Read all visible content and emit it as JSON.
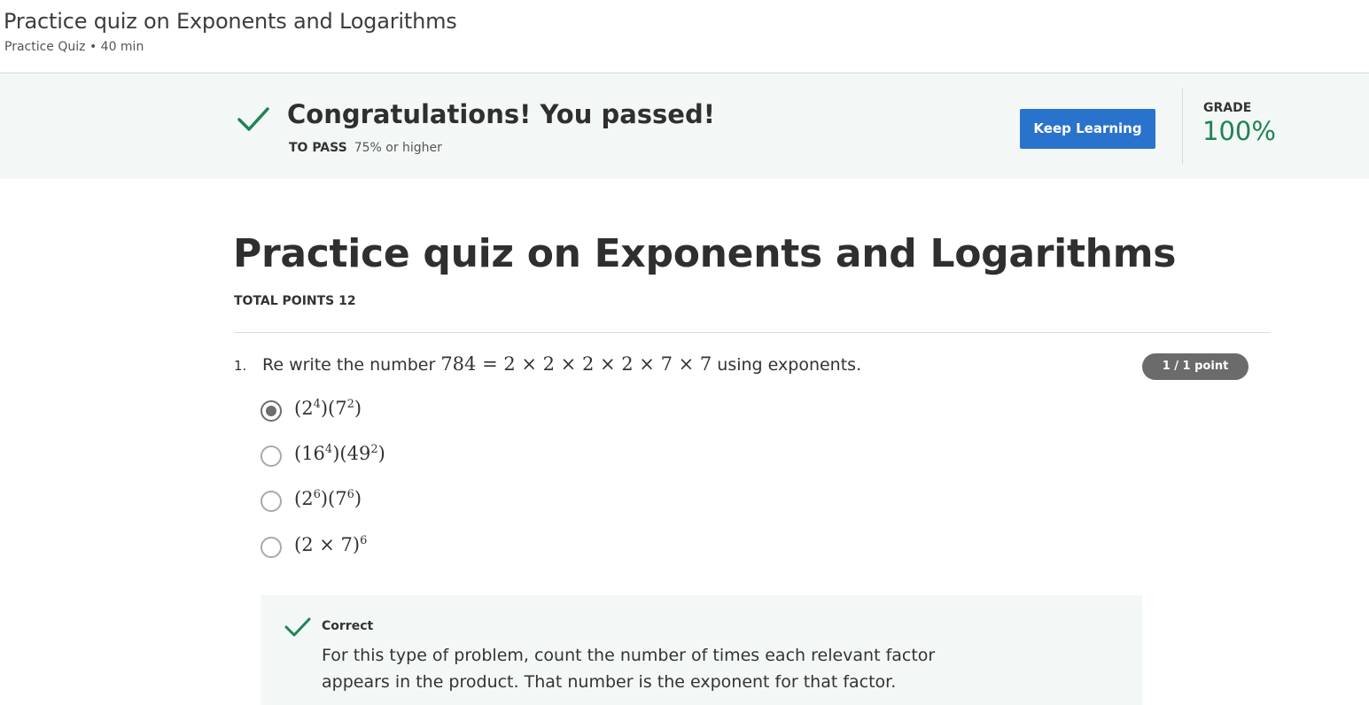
{
  "header": {
    "title": "Practice quiz on Exponents and Logarithms",
    "meta": "Practice Quiz • 40 min"
  },
  "banner": {
    "headline": "Congratulations! You passed!",
    "to_pass_label": "TO PASS",
    "to_pass_value": "75% or higher",
    "button_label": "Keep Learning",
    "grade_label": "GRADE",
    "grade_value": "100%"
  },
  "quiz": {
    "title": "Practice quiz on Exponents and Logarithms",
    "total_points": "TOTAL POINTS 12"
  },
  "question": {
    "number": "1.",
    "prefix": "Re write the number",
    "expression": "784 = 2 × 2 × 2 × 2 × 7 × 7",
    "suffix": "using exponents.",
    "points": "1 / 1 point",
    "options": [
      {
        "base1": "(2",
        "exp1": "4",
        "mid": ")(7",
        "exp2": "2",
        "end": ")",
        "selected": true
      },
      {
        "base1": "(16",
        "exp1": "4",
        "mid": ")(49",
        "exp2": "2",
        "end": ")",
        "selected": false
      },
      {
        "base1": "(2",
        "exp1": "6",
        "mid": ")(7",
        "exp2": "6",
        "end": ")",
        "selected": false
      },
      {
        "base1": "(2 × 7)",
        "exp1": "6",
        "mid": "",
        "exp2": "",
        "end": "",
        "selected": false
      }
    ]
  },
  "feedback": {
    "label": "Correct",
    "text": "For this type of problem, count the number of times each relevant factor appears in the product. That number is the exponent for that factor."
  },
  "colors": {
    "banner_bg": "#f3f8f6",
    "success_green": "#1f8354",
    "button_blue": "#2a73cc",
    "badge_gray": "#6b6b6b"
  },
  "icons": {
    "banner_check": "check-icon",
    "feedback_check": "check-icon"
  }
}
